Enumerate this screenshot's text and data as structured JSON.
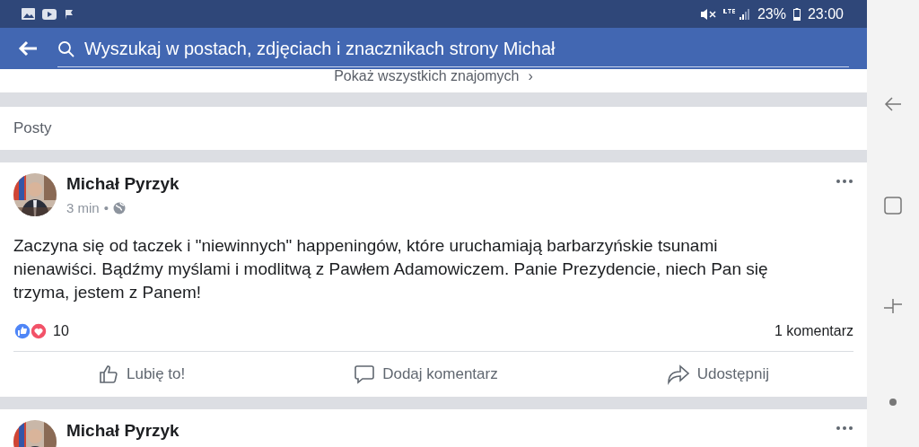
{
  "status_bar": {
    "battery": "23%",
    "time": "23:00"
  },
  "search": {
    "placeholder": "Wyszukaj w postach, zdjęciach i znacznikach strony Michał"
  },
  "friends_link": {
    "label": "Pokaż wszystkich znajomych",
    "chevron": "›"
  },
  "section_title": "Posty",
  "posts": [
    {
      "author": "Michał Pyrzyk",
      "time": "3 min",
      "separator": "•",
      "text": "Zaczyna się od taczek i \"niewinnych\" happeningów, które uruchamiają barbarzyńskie tsunami nienawiści. Bądźmy myślami i modlitwą z Pawłem Adamowiczem. Panie Prezydencie, niech Pan się trzyma, jestem z Panem!",
      "reactions": "10",
      "comments": "1 komentarz",
      "actions": [
        {
          "kind": "like",
          "label": "Lubię to!"
        },
        {
          "kind": "comment",
          "label": "Dodaj komentarz"
        },
        {
          "kind": "share",
          "label": "Udostępnij"
        }
      ]
    },
    {
      "author": "Michał Pyrzyk"
    }
  ]
}
